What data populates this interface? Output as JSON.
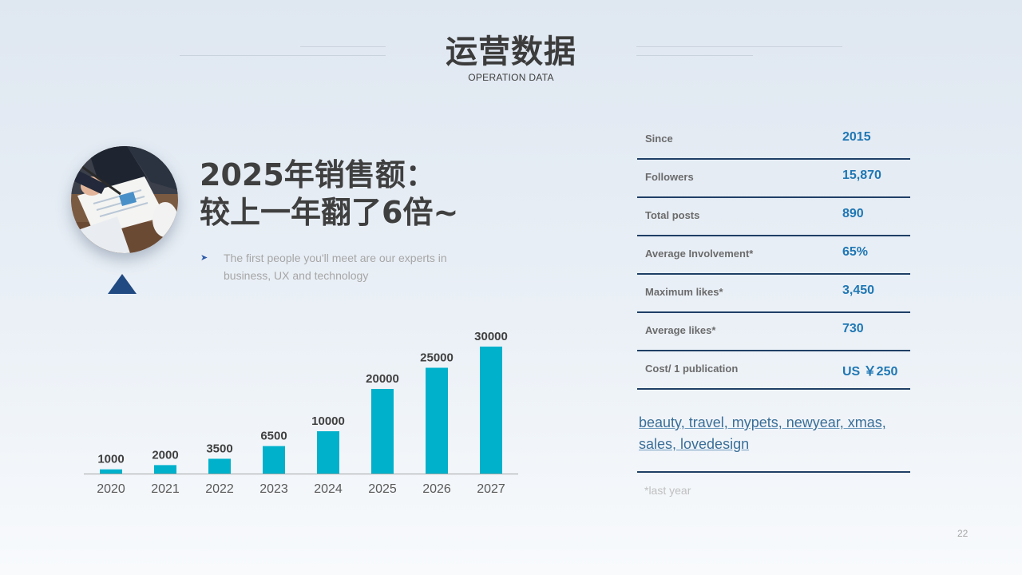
{
  "header": {
    "title": "运营数据",
    "subtitle": "OPERATION DATA"
  },
  "hero": {
    "headline_line1": "2025年销售额：",
    "headline_line2": "较上一年翻了6倍~",
    "description": "The first people you'll meet are our experts in business, UX  and technology"
  },
  "colors": {
    "bar": "#00b1cc",
    "accent": "#1f77b4",
    "triangle": "#214a82",
    "divider": "#1f3f66"
  },
  "chart_data": {
    "type": "bar",
    "categories": [
      "2020",
      "2021",
      "2022",
      "2023",
      "2024",
      "2025",
      "2026",
      "2027"
    ],
    "values": [
      1000,
      2000,
      3500,
      6500,
      10000,
      20000,
      25000,
      30000
    ],
    "data_labels": true,
    "ylim": [
      0,
      30000
    ],
    "grid": false,
    "legend": "none"
  },
  "stats": [
    {
      "label": "Since",
      "value": "2015"
    },
    {
      "label": "Followers",
      "value": "15,870"
    },
    {
      "label": "Total posts",
      "value": "890"
    },
    {
      "label": "Average Involvement*",
      "value": "65%"
    },
    {
      "label": "Maximum likes*",
      "value": "3,450"
    },
    {
      "label": "Average likes*",
      "value": "730"
    },
    {
      "label": "Cost/  1 publication",
      "value": "US ￥250"
    }
  ],
  "tags": "beauty, travel, mypets, newyear, xmas, sales, lovedesign",
  "footnote": "*last year",
  "page_number": "22"
}
